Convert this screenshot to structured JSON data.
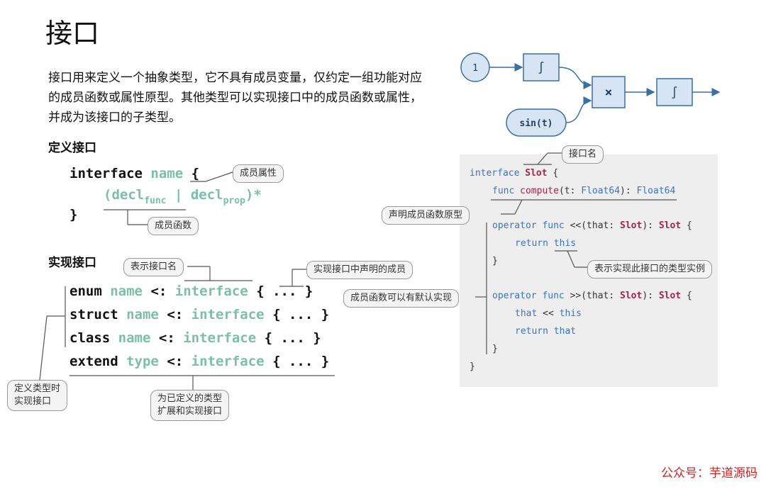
{
  "title": "接口",
  "intro": "接口用来定义一个抽象类型，它不具有成员变量，仅约定一组功能对应的成员函数或属性原型。其他类型可以实现接口中的成员函数或属性，并成为该接口的子类型。",
  "define_section": {
    "heading": "定义接口",
    "line1_kw": "interface",
    "line1_name": "name",
    "line1_brace": "{",
    "line2_open": "(decl",
    "line2_func_sub": "func",
    "line2_bar": " | ",
    "line2_decl2": "decl",
    "line2_prop_sub": "prop",
    "line2_close": ")*",
    "line3": "}",
    "callout_prop": "成员属性",
    "callout_func": "成员函数"
  },
  "impl_section": {
    "heading": "实现接口",
    "callout_name": "表示接口名",
    "callout_members": "实现接口中声明的成员",
    "callout_define": "定义类型时\n实现接口",
    "callout_extend": "为已定义的类型\n扩展和实现接口",
    "rows": [
      {
        "kw": "enum",
        "name": "name",
        "op": "<:",
        "iface": "interface",
        "body": "{ ... }"
      },
      {
        "kw": "struct",
        "name": "name",
        "op": "<:",
        "iface": "interface",
        "body": "{ ... }"
      },
      {
        "kw": "class",
        "name": "name",
        "op": "<:",
        "iface": "interface",
        "body": "{ ... }"
      },
      {
        "kw": "extend",
        "name": "type",
        "op": "<:",
        "iface": "interface",
        "body": "{ ... }"
      }
    ]
  },
  "flow_diagram": {
    "input_const": "1",
    "input_sin": "sin(t)",
    "integral1": "∫",
    "multiply": "×",
    "integral2": "∫"
  },
  "code_panel": {
    "callout_iface_name": "接口名",
    "callout_decl": "声明成员函数原型",
    "callout_this": "表示实现此接口的类型实例",
    "callout_default": "成员函数可以有默认实现",
    "l1_kw": "interface ",
    "l1_name": "Slot",
    "l1_brace": " {",
    "l2_kw": "func ",
    "l2_fn": "compute",
    "l2_p1": "(t: ",
    "l2_type": "Float64",
    "l2_p2": "): ",
    "l2_ret": "Float64",
    "l3_kw": "operator func ",
    "l3_op": "<<",
    "l3_p1": "(that: ",
    "l3_t1": "Slot",
    "l3_p2": "): ",
    "l3_t2": "Slot",
    "l3_brace": " {",
    "l4_kw": "return ",
    "l4_val": "this",
    "l5": "}",
    "l6_kw": "operator func ",
    "l6_op": ">>",
    "l6_p1": "(that: ",
    "l6_t1": "Slot",
    "l6_p2": "): ",
    "l6_t2": "Slot",
    "l6_brace": " {",
    "l7_a": "that",
    "l7_op": " << ",
    "l7_b": "this",
    "l8_kw": "return ",
    "l8_val": "that",
    "l9": "}",
    "l10": "}"
  },
  "watermark": "公众号：芋道源码",
  "colors": {
    "teal": "#7bbfa9",
    "blue": "#3b74c4",
    "red": "#a8234a",
    "node_fill": "#d6e4f3",
    "node_stroke": "#3a6fa5"
  }
}
